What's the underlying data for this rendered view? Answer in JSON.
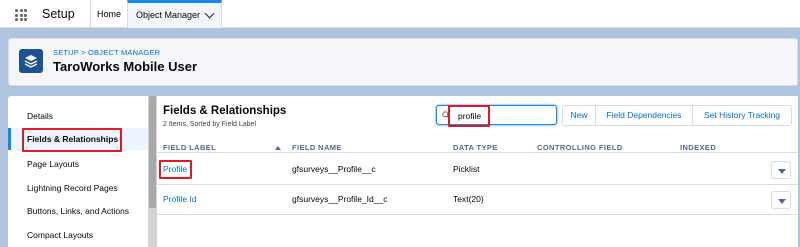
{
  "topbar": {
    "app_name": "Setup",
    "home_tab": "Home",
    "object_manager_tab": "Object Manager"
  },
  "header": {
    "breadcrumb": "SETUP > OBJECT MANAGER",
    "title": "TaroWorks Mobile User"
  },
  "sidebar": {
    "items": [
      {
        "label": "Details"
      },
      {
        "label": "Fields & Relationships"
      },
      {
        "label": "Page Layouts"
      },
      {
        "label": "Lightning Record Pages"
      },
      {
        "label": "Buttons, Links, and Actions"
      },
      {
        "label": "Compact Layouts"
      }
    ],
    "active_index": 1
  },
  "main": {
    "title": "Fields & Relationships",
    "subtitle": "2 Items, Sorted by Field Label",
    "search": {
      "value": "profile",
      "placeholder": ""
    },
    "buttons": {
      "new": "New",
      "field_dependencies": "Field Dependencies",
      "set_history_tracking": "Set History Tracking"
    },
    "columns": [
      "FIELD LABEL",
      "FIELD NAME",
      "DATA TYPE",
      "CONTROLLING FIELD",
      "INDEXED"
    ],
    "rows": [
      {
        "label": "Profile",
        "name": "gfsurveys__Profile__c",
        "type": "Picklist",
        "controlling": "",
        "indexed": ""
      },
      {
        "label": "Profile Id",
        "name": "gfsurveys__Profile_Id__c",
        "type": "Text(20)",
        "controlling": "",
        "indexed": ""
      }
    ]
  },
  "colors": {
    "accent": "#1589ee",
    "link": "#0070d2",
    "highlight": "#e01a24",
    "header_icon": "#1b5297",
    "page_bg": "#b0c4df"
  },
  "icons": [
    "app-launcher-icon",
    "chevron-down-icon",
    "layers-icon",
    "search-icon",
    "sort-ascending-icon",
    "row-action-chevron-icon"
  ]
}
